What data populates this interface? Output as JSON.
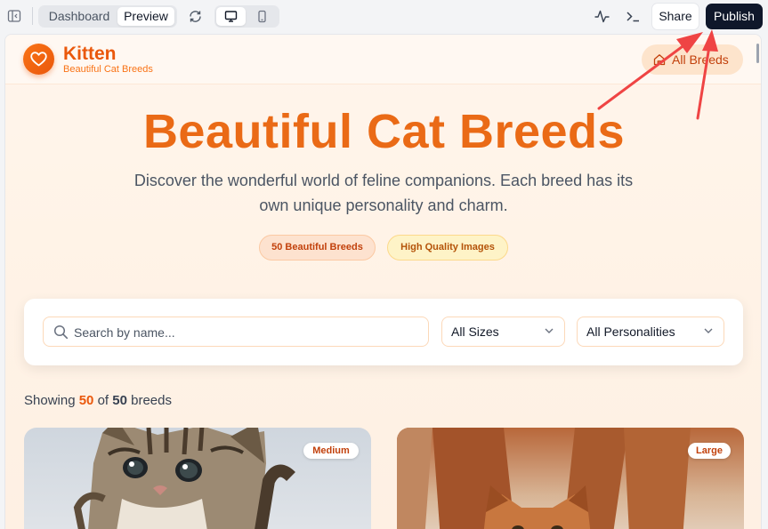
{
  "topbar": {
    "tabs": [
      {
        "label": "Dashboard",
        "active": false
      },
      {
        "label": "Preview",
        "active": true
      }
    ],
    "share_label": "Share",
    "publish_label": "Publish",
    "icons": [
      "sidebar-toggle-icon",
      "refresh-icon",
      "desktop-icon",
      "mobile-icon",
      "activity-icon",
      "terminal-icon"
    ]
  },
  "site": {
    "brand": "Kitten",
    "brand_subtitle": "Beautiful Cat Breeds",
    "nav_all_breeds": "All Breeds",
    "hero": {
      "title": "Beautiful Cat Breeds",
      "description": "Discover the wonderful world of feline companions. Each breed has its own unique personality and charm.",
      "pills": [
        "50 Beautiful Breeds",
        "High Quality Images"
      ]
    },
    "filters": {
      "search_placeholder": "Search by name...",
      "size_selected": "All Sizes",
      "personality_selected": "All Personalities"
    },
    "results": {
      "prefix": "Showing",
      "shown": "50",
      "of": "of",
      "total": "50",
      "suffix": "breeds"
    },
    "cards": [
      {
        "size_badge": "Medium",
        "image": "tabby-kitten"
      },
      {
        "size_badge": "Large",
        "image": "ginger-cat"
      }
    ]
  },
  "colors": {
    "accent": "#ea580c",
    "publish_bg": "#0f172a",
    "annotation": "#ef4444"
  }
}
